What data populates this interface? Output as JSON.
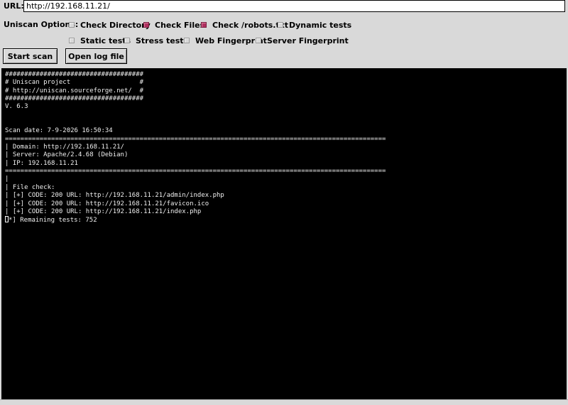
{
  "url": {
    "label": "URL:",
    "value": "http://192.168.11.21/"
  },
  "options": {
    "label": "Uniscan Options:",
    "items": [
      {
        "label": "Check Directory",
        "checked": false
      },
      {
        "label": "Check Files",
        "checked": true
      },
      {
        "label": "Check /robots.txt",
        "checked": true
      },
      {
        "label": "Dynamic tests",
        "checked": false
      },
      {
        "label": "Static tests",
        "checked": false
      },
      {
        "label": "Stress tests",
        "checked": false
      },
      {
        "label": "Web Fingerprint",
        "checked": false
      },
      {
        "label": "Server Fingerprint",
        "checked": false
      }
    ]
  },
  "buttons": {
    "start": "Start scan",
    "log": "Open log file"
  },
  "output": {
    "lines": [
      "####################################",
      "# Uniscan project                  #",
      "# http://uniscan.sourceforge.net/  #",
      "####################################",
      "V. 6.3",
      "",
      "",
      "Scan date: 7-9-2026 16:50:34",
      "===================================================================================================",
      "| Domain: http://192.168.11.21/",
      "| Server: Apache/2.4.68 (Debian)",
      "| IP: 192.168.11.21",
      "===================================================================================================",
      "|",
      "| File check:",
      "| [+] CODE: 200 URL: http://192.168.11.21/admin/index.php",
      "| [+] CODE: 200 URL: http://192.168.11.21/favicon.ico",
      "| [+] CODE: 200 URL: http://192.168.11.21/index.php"
    ],
    "last_line_prefix": "[",
    "last_line_rest": "*] Remaining tests: 752"
  }
}
